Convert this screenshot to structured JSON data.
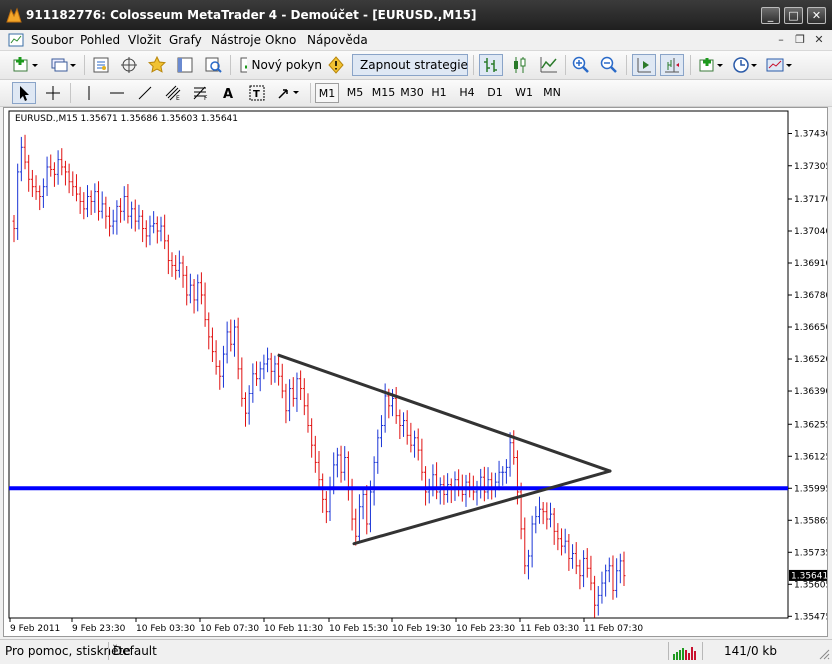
{
  "window": {
    "title": "911182776: Colosseum MetaTrader 4 - Demoúčet - [EURUSD.,M15]"
  },
  "menu": [
    "Soubor",
    "Pohled",
    "Vložit",
    "Grafy",
    "Nástroje",
    "Okno",
    "Nápověda"
  ],
  "toolbar": {
    "new_order_label": "Nový pokyn",
    "autotrading_label": "Zapnout strategie"
  },
  "timeframes": [
    "M1",
    "M5",
    "M15",
    "M30",
    "H1",
    "H4",
    "D1",
    "W1",
    "MN"
  ],
  "selected_timeframe": "M1",
  "chart": {
    "info": "EURUSD.,M15  1.35671 1.35686 1.35603 1.35641",
    "current_price": "1.35641"
  },
  "chart_data": {
    "type": "bar",
    "symbol": "EURUSD.",
    "timeframe": "M15",
    "price_axis_labels": [
      "1.37436",
      "1.37305",
      "1.37170",
      "1.37040",
      "1.36910",
      "1.36780",
      "1.36650",
      "1.36520",
      "1.36390",
      "1.36255",
      "1.36125",
      "1.35995",
      "1.35865",
      "1.35735",
      "1.35605",
      "1.35475"
    ],
    "price_axis_values": [
      1.37436,
      1.37305,
      1.3717,
      1.3704,
      1.3691,
      1.3678,
      1.3665,
      1.3652,
      1.3639,
      1.36255,
      1.36125,
      1.35995,
      1.35865,
      1.35735,
      1.35605,
      1.35475
    ],
    "time_axis_labels": [
      "9 Feb 2011",
      "9 Feb 23:30",
      "10 Feb 03:30",
      "10 Feb 07:30",
      "10 Feb 11:30",
      "10 Feb 15:30",
      "10 Feb 19:30",
      "10 Feb 23:30",
      "11 Feb 03:30",
      "11 Feb 07:30"
    ],
    "ylim": [
      1.35445,
      1.37465
    ],
    "horizontal_line": 1.35995,
    "triangle_lines": [
      {
        "from": [
          "10 Feb 11:30",
          1.36535
        ],
        "to": [
          "11 Feb 03:30",
          1.36065
        ]
      },
      {
        "from": [
          "10 Feb 15:30",
          1.3577
        ],
        "to": [
          "11 Feb 03:30",
          1.36065
        ]
      },
      {
        "from": [
          "10 Feb 11:30",
          1.36535
        ],
        "to": [
          "10 Feb 15:30",
          1.3577
        ]
      }
    ],
    "series": [
      {
        "values": [
          1.3705,
          1.3728,
          1.3738,
          1.3732,
          1.3725,
          1.3722,
          1.372,
          1.3718,
          1.3722,
          1.373,
          1.3729,
          1.3727,
          1.3733,
          1.373,
          1.3728,
          1.3724,
          1.3722,
          1.3719,
          1.3716,
          1.3713,
          1.3718,
          1.3716,
          1.372,
          1.3712,
          1.3715,
          1.371,
          1.3706,
          1.3708,
          1.3714,
          1.3712,
          1.3718,
          1.371,
          1.3713,
          1.3708,
          1.371,
          1.3705,
          1.3702,
          1.3706,
          1.3707,
          1.3704,
          1.3706,
          1.37,
          1.3692,
          1.369,
          1.3688,
          1.3691,
          1.3686,
          1.3678,
          1.3682,
          1.3676,
          1.3683,
          1.3678,
          1.3668,
          1.3661,
          1.3655,
          1.3649,
          1.3645,
          1.3654,
          1.3663,
          1.3658,
          1.3665,
          1.3648,
          1.3636,
          1.363,
          1.3638,
          1.3646,
          1.3644,
          1.3648,
          1.365,
          1.3652,
          1.3647,
          1.365,
          1.3645,
          1.3639,
          1.3631,
          1.364,
          1.3636,
          1.3644,
          1.364,
          1.3633,
          1.3625,
          1.3617,
          1.361,
          1.3603,
          1.3595,
          1.359,
          1.36,
          1.3609,
          1.3613,
          1.3606,
          1.3612,
          1.36,
          1.3587,
          1.358,
          1.3592,
          1.3597,
          1.3585,
          1.3598,
          1.361,
          1.362,
          1.3625,
          1.3637,
          1.3633,
          1.3636,
          1.3629,
          1.3625,
          1.3627,
          1.3621,
          1.3617,
          1.362,
          1.3615,
          1.3606,
          1.3598,
          1.36,
          1.3605,
          1.3598,
          1.3601,
          1.3597,
          1.3601,
          1.3599,
          1.3603,
          1.36,
          1.3597,
          1.3602,
          1.36,
          1.3598,
          1.36,
          1.3604,
          1.3598,
          1.3603,
          1.36,
          1.3602,
          1.3606,
          1.3606,
          1.3608,
          1.3618,
          1.3612,
          1.3598,
          1.3583,
          1.3568,
          1.3572,
          1.3585,
          1.3588,
          1.3591,
          1.359,
          1.3587,
          1.3589,
          1.3582,
          1.3579,
          1.3576,
          1.3578,
          1.3571,
          1.3573,
          1.3568,
          1.3564,
          1.3571,
          1.3567,
          1.3561,
          1.3552,
          1.3556,
          1.3561,
          1.3566,
          1.3568,
          1.3558,
          1.3566,
          1.357,
          1.3564
        ]
      }
    ]
  },
  "status": {
    "help_text": "Pro pomoc, stiskněte",
    "profile": "Default",
    "traffic": "141/0 kb"
  }
}
